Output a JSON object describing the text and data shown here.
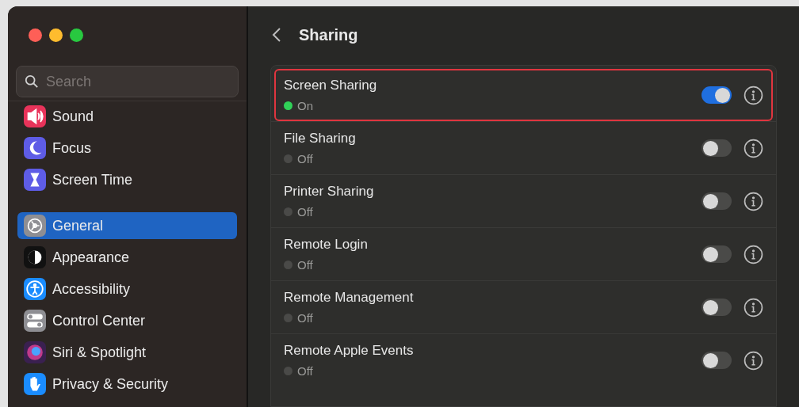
{
  "sidebar": {
    "search": {
      "placeholder": "Search"
    },
    "items": [
      {
        "label": "Sound",
        "selected": false
      },
      {
        "label": "Focus",
        "selected": false
      },
      {
        "label": "Screen Time",
        "selected": false
      },
      {
        "label": "General",
        "selected": true
      },
      {
        "label": "Appearance",
        "selected": false
      },
      {
        "label": "Accessibility",
        "selected": false
      },
      {
        "label": "Control Center",
        "selected": false
      },
      {
        "label": "Siri & Spotlight",
        "selected": false
      },
      {
        "label": "Privacy & Security",
        "selected": false
      }
    ]
  },
  "header": {
    "title": "Sharing"
  },
  "services": [
    {
      "name": "Screen Sharing",
      "on": true,
      "status": "On",
      "selected": true
    },
    {
      "name": "File Sharing",
      "on": false,
      "status": "Off",
      "selected": false
    },
    {
      "name": "Printer Sharing",
      "on": false,
      "status": "Off",
      "selected": false
    },
    {
      "name": "Remote Login",
      "on": false,
      "status": "Off",
      "selected": false
    },
    {
      "name": "Remote Management",
      "on": false,
      "status": "Off",
      "selected": false
    },
    {
      "name": "Remote Apple Events",
      "on": false,
      "status": "Off",
      "selected": false
    }
  ]
}
